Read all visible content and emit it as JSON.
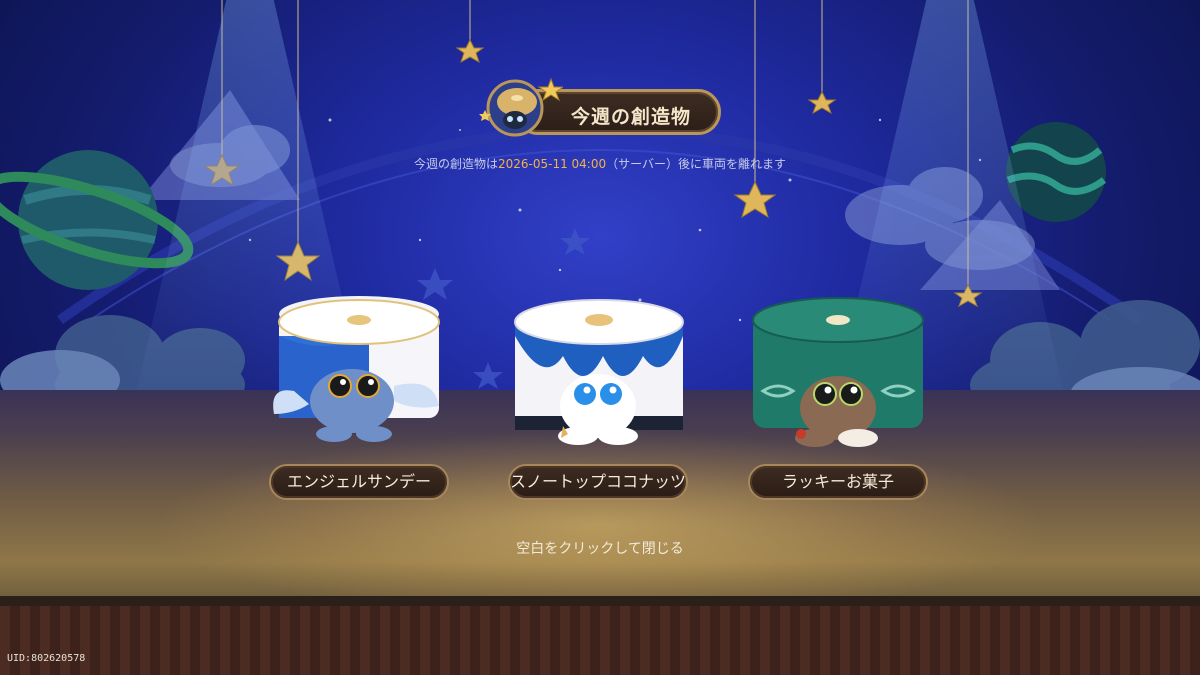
{
  "banner": {
    "title": "今週の創造物",
    "icon": "cat-in-cake-icon"
  },
  "subtitle": {
    "prefix": "今週の創造物は",
    "date": "2026-05-11 04:00",
    "suffix": "（サーバー）後に車両を離れます"
  },
  "items": [
    {
      "label": "エンジェルサンデー",
      "icon": "angel-sundae-creature",
      "color": "#2f6fd8"
    },
    {
      "label": "スノートップココナッツ",
      "icon": "snowtop-coconut-creature",
      "color": "#1f5fc0"
    },
    {
      "label": "ラッキーお菓子",
      "icon": "lucky-sweets-creature",
      "color": "#1f7a6a"
    }
  ],
  "close_hint": "空白をクリックして閉じる",
  "uid": "UID:802620578",
  "colors": {
    "accent_gold": "#f2b24a",
    "plate_border": "#b9965a",
    "plate_fill": "#2c1f18"
  }
}
